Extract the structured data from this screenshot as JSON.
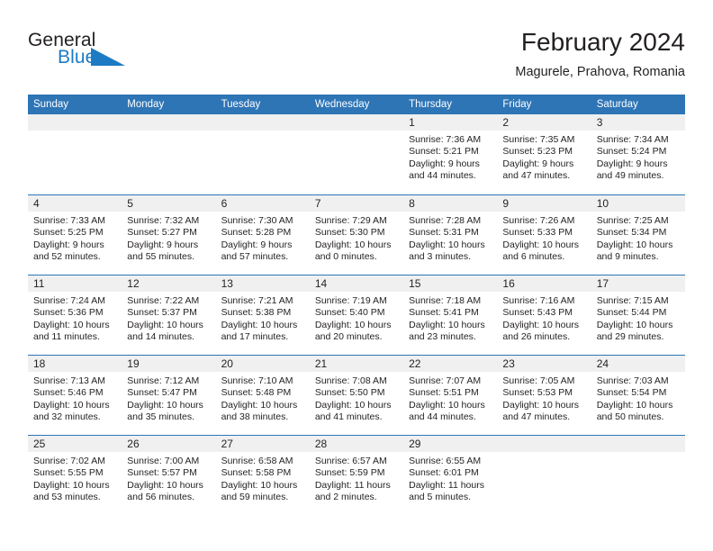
{
  "brand": {
    "word_one": "General",
    "word_two": "Blue",
    "triangle_icon": "triangle-logo-icon",
    "colors": {
      "text": "#231f20",
      "blue": "#1d7bc3"
    }
  },
  "header": {
    "title": "February 2024",
    "location": "Magurele, Prahova, Romania"
  },
  "colors": {
    "header_blue": "#2e75b6",
    "daynum_band": "#f0f0f0",
    "cell_bg": "#ffffff",
    "text": "#231f20"
  },
  "weekdays": [
    "Sunday",
    "Monday",
    "Tuesday",
    "Wednesday",
    "Thursday",
    "Friday",
    "Saturday"
  ],
  "weeks": [
    [
      {
        "day": "",
        "empty": true,
        "lines": []
      },
      {
        "day": "",
        "empty": true,
        "lines": []
      },
      {
        "day": "",
        "empty": true,
        "lines": []
      },
      {
        "day": "",
        "empty": true,
        "lines": []
      },
      {
        "day": "1",
        "empty": false,
        "lines": [
          "Sunrise: 7:36 AM",
          "Sunset: 5:21 PM",
          "Daylight: 9 hours",
          "and 44 minutes."
        ]
      },
      {
        "day": "2",
        "empty": false,
        "lines": [
          "Sunrise: 7:35 AM",
          "Sunset: 5:23 PM",
          "Daylight: 9 hours",
          "and 47 minutes."
        ]
      },
      {
        "day": "3",
        "empty": false,
        "lines": [
          "Sunrise: 7:34 AM",
          "Sunset: 5:24 PM",
          "Daylight: 9 hours",
          "and 49 minutes."
        ]
      }
    ],
    [
      {
        "day": "4",
        "empty": false,
        "lines": [
          "Sunrise: 7:33 AM",
          "Sunset: 5:25 PM",
          "Daylight: 9 hours",
          "and 52 minutes."
        ]
      },
      {
        "day": "5",
        "empty": false,
        "lines": [
          "Sunrise: 7:32 AM",
          "Sunset: 5:27 PM",
          "Daylight: 9 hours",
          "and 55 minutes."
        ]
      },
      {
        "day": "6",
        "empty": false,
        "lines": [
          "Sunrise: 7:30 AM",
          "Sunset: 5:28 PM",
          "Daylight: 9 hours",
          "and 57 minutes."
        ]
      },
      {
        "day": "7",
        "empty": false,
        "lines": [
          "Sunrise: 7:29 AM",
          "Sunset: 5:30 PM",
          "Daylight: 10 hours",
          "and 0 minutes."
        ]
      },
      {
        "day": "8",
        "empty": false,
        "lines": [
          "Sunrise: 7:28 AM",
          "Sunset: 5:31 PM",
          "Daylight: 10 hours",
          "and 3 minutes."
        ]
      },
      {
        "day": "9",
        "empty": false,
        "lines": [
          "Sunrise: 7:26 AM",
          "Sunset: 5:33 PM",
          "Daylight: 10 hours",
          "and 6 minutes."
        ]
      },
      {
        "day": "10",
        "empty": false,
        "lines": [
          "Sunrise: 7:25 AM",
          "Sunset: 5:34 PM",
          "Daylight: 10 hours",
          "and 9 minutes."
        ]
      }
    ],
    [
      {
        "day": "11",
        "empty": false,
        "lines": [
          "Sunrise: 7:24 AM",
          "Sunset: 5:36 PM",
          "Daylight: 10 hours",
          "and 11 minutes."
        ]
      },
      {
        "day": "12",
        "empty": false,
        "lines": [
          "Sunrise: 7:22 AM",
          "Sunset: 5:37 PM",
          "Daylight: 10 hours",
          "and 14 minutes."
        ]
      },
      {
        "day": "13",
        "empty": false,
        "lines": [
          "Sunrise: 7:21 AM",
          "Sunset: 5:38 PM",
          "Daylight: 10 hours",
          "and 17 minutes."
        ]
      },
      {
        "day": "14",
        "empty": false,
        "lines": [
          "Sunrise: 7:19 AM",
          "Sunset: 5:40 PM",
          "Daylight: 10 hours",
          "and 20 minutes."
        ]
      },
      {
        "day": "15",
        "empty": false,
        "lines": [
          "Sunrise: 7:18 AM",
          "Sunset: 5:41 PM",
          "Daylight: 10 hours",
          "and 23 minutes."
        ]
      },
      {
        "day": "16",
        "empty": false,
        "lines": [
          "Sunrise: 7:16 AM",
          "Sunset: 5:43 PM",
          "Daylight: 10 hours",
          "and 26 minutes."
        ]
      },
      {
        "day": "17",
        "empty": false,
        "lines": [
          "Sunrise: 7:15 AM",
          "Sunset: 5:44 PM",
          "Daylight: 10 hours",
          "and 29 minutes."
        ]
      }
    ],
    [
      {
        "day": "18",
        "empty": false,
        "lines": [
          "Sunrise: 7:13 AM",
          "Sunset: 5:46 PM",
          "Daylight: 10 hours",
          "and 32 minutes."
        ]
      },
      {
        "day": "19",
        "empty": false,
        "lines": [
          "Sunrise: 7:12 AM",
          "Sunset: 5:47 PM",
          "Daylight: 10 hours",
          "and 35 minutes."
        ]
      },
      {
        "day": "20",
        "empty": false,
        "lines": [
          "Sunrise: 7:10 AM",
          "Sunset: 5:48 PM",
          "Daylight: 10 hours",
          "and 38 minutes."
        ]
      },
      {
        "day": "21",
        "empty": false,
        "lines": [
          "Sunrise: 7:08 AM",
          "Sunset: 5:50 PM",
          "Daylight: 10 hours",
          "and 41 minutes."
        ]
      },
      {
        "day": "22",
        "empty": false,
        "lines": [
          "Sunrise: 7:07 AM",
          "Sunset: 5:51 PM",
          "Daylight: 10 hours",
          "and 44 minutes."
        ]
      },
      {
        "day": "23",
        "empty": false,
        "lines": [
          "Sunrise: 7:05 AM",
          "Sunset: 5:53 PM",
          "Daylight: 10 hours",
          "and 47 minutes."
        ]
      },
      {
        "day": "24",
        "empty": false,
        "lines": [
          "Sunrise: 7:03 AM",
          "Sunset: 5:54 PM",
          "Daylight: 10 hours",
          "and 50 minutes."
        ]
      }
    ],
    [
      {
        "day": "25",
        "empty": false,
        "lines": [
          "Sunrise: 7:02 AM",
          "Sunset: 5:55 PM",
          "Daylight: 10 hours",
          "and 53 minutes."
        ]
      },
      {
        "day": "26",
        "empty": false,
        "lines": [
          "Sunrise: 7:00 AM",
          "Sunset: 5:57 PM",
          "Daylight: 10 hours",
          "and 56 minutes."
        ]
      },
      {
        "day": "27",
        "empty": false,
        "lines": [
          "Sunrise: 6:58 AM",
          "Sunset: 5:58 PM",
          "Daylight: 10 hours",
          "and 59 minutes."
        ]
      },
      {
        "day": "28",
        "empty": false,
        "lines": [
          "Sunrise: 6:57 AM",
          "Sunset: 5:59 PM",
          "Daylight: 11 hours",
          "and 2 minutes."
        ]
      },
      {
        "day": "29",
        "empty": false,
        "lines": [
          "Sunrise: 6:55 AM",
          "Sunset: 6:01 PM",
          "Daylight: 11 hours",
          "and 5 minutes."
        ]
      },
      {
        "day": "",
        "empty": true,
        "lines": []
      },
      {
        "day": "",
        "empty": true,
        "lines": []
      }
    ]
  ]
}
